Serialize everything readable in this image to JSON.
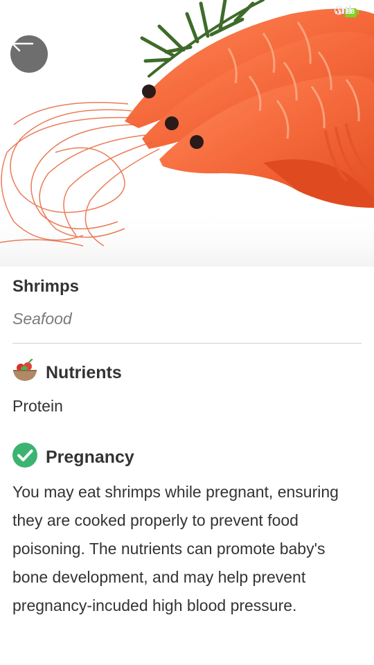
{
  "status_bar": {
    "battery_level": "88",
    "battery_color": "#7ed321"
  },
  "header": {
    "back_icon": "arrow-left-icon"
  },
  "food": {
    "name": "Shrimps",
    "category": "Seafood"
  },
  "nutrients": {
    "icon": "food-bowl-icon",
    "heading": "Nutrients",
    "value": "Protein"
  },
  "pregnancy": {
    "icon": "check-circle-icon",
    "icon_color": "#3cb371",
    "heading": "Pregnancy",
    "description": "You may eat shrimps while pregnant, ensuring they are cooked properly to prevent food poisoning. The nutrients can promote baby's bone development, and may help prevent pregnancy-incuded high blood pressure."
  }
}
